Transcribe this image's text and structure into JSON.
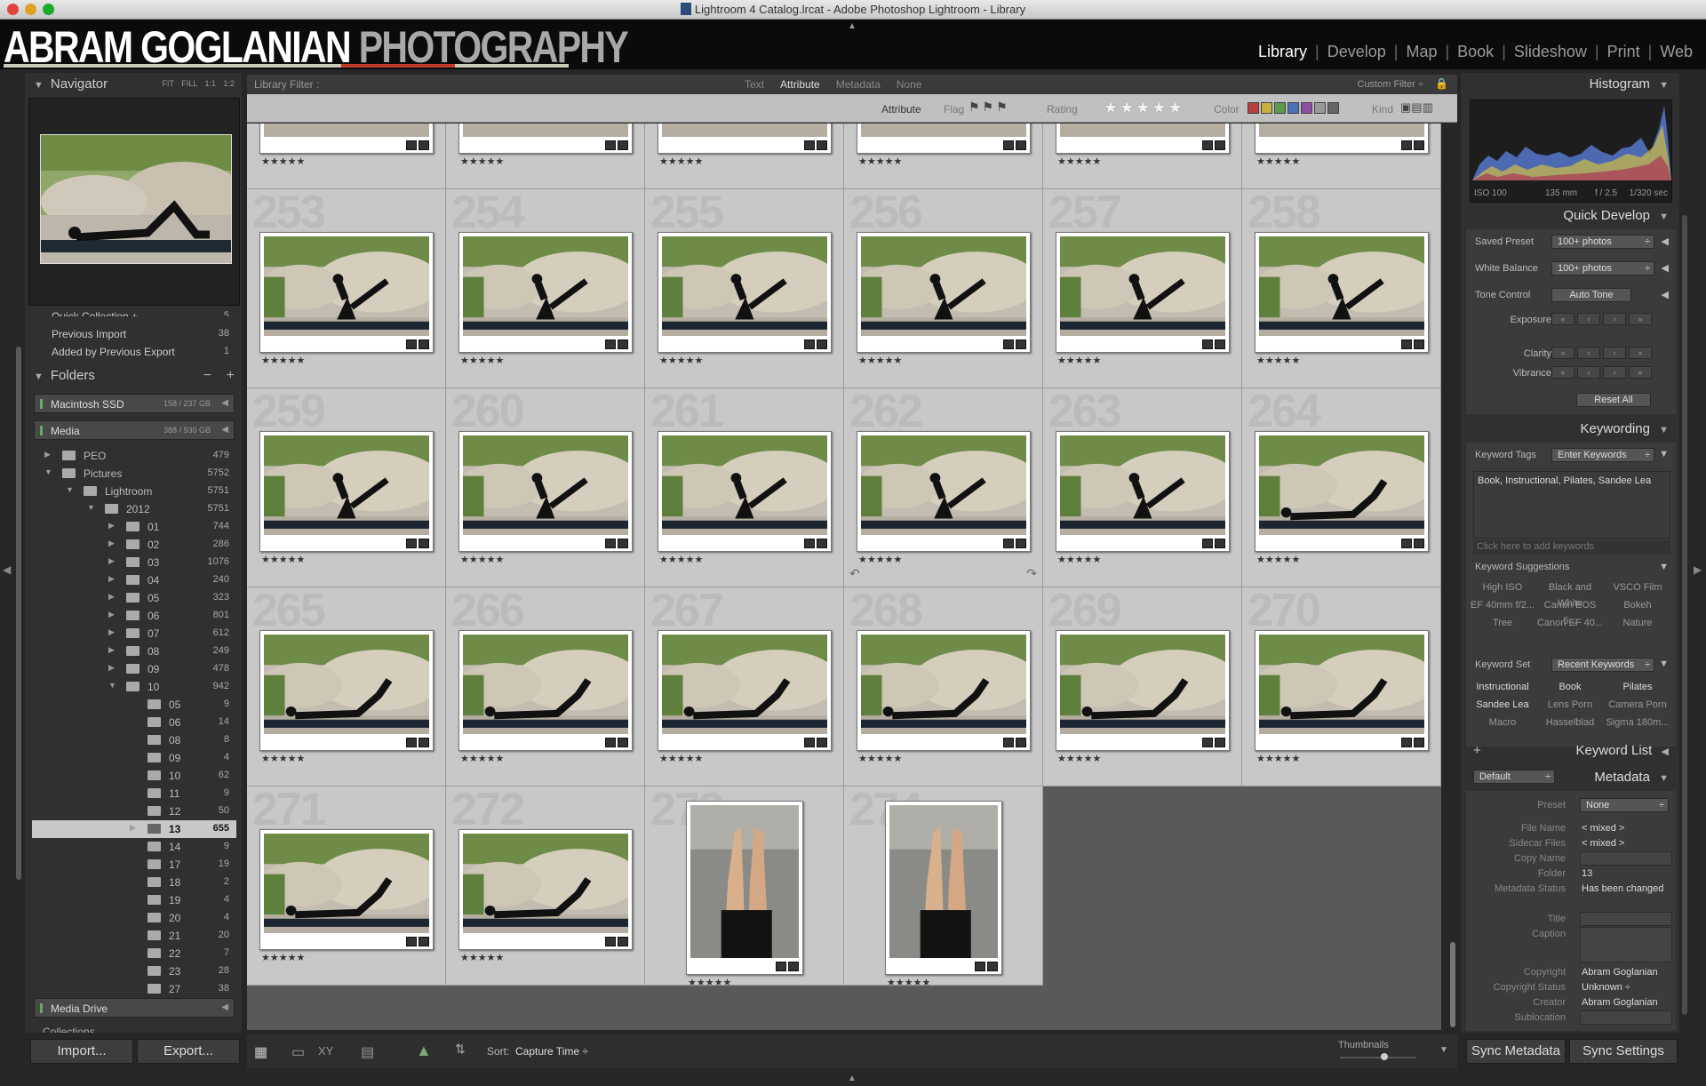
{
  "window": {
    "title": "Lightroom 4 Catalog.lrcat - Adobe Photoshop Lightroom - Library"
  },
  "identity": {
    "name_part1": "ABRAM GOGLANIAN",
    "name_part2": "PHOTOGRAPHY"
  },
  "modules": [
    "Library",
    "Develop",
    "Map",
    "Book",
    "Slideshow",
    "Print",
    "Web"
  ],
  "left": {
    "navigator": {
      "title": "Navigator",
      "zoom": [
        "FIT",
        "FILL",
        "1:1",
        "1:2"
      ]
    },
    "catalog": [
      {
        "label": "Quick Collection +",
        "count": "5"
      },
      {
        "label": "Previous Import",
        "count": "38"
      },
      {
        "label": "Added by Previous Export",
        "count": "1"
      }
    ],
    "folders": {
      "title": "Folders",
      "minus": "−",
      "plus": "+"
    },
    "volumes": [
      {
        "name": "Macintosh SSD",
        "size": "158 / 237 GB"
      },
      {
        "name": "Media",
        "size": "388 / 930 GB"
      },
      {
        "name": "Media Drive",
        "size": ""
      }
    ],
    "tree": [
      {
        "name": "PEO",
        "count": "479",
        "depth": 0,
        "arrow": "▶"
      },
      {
        "name": "Pictures",
        "count": "5752",
        "depth": 0,
        "arrow": "▼"
      },
      {
        "name": "Lightroom",
        "count": "5751",
        "depth": 1,
        "arrow": "▼"
      },
      {
        "name": "2012",
        "count": "5751",
        "depth": 2,
        "arrow": "▼"
      },
      {
        "name": "01",
        "count": "744",
        "depth": 3,
        "arrow": "▶"
      },
      {
        "name": "02",
        "count": "286",
        "depth": 3,
        "arrow": "▶"
      },
      {
        "name": "03",
        "count": "1076",
        "depth": 3,
        "arrow": "▶"
      },
      {
        "name": "04",
        "count": "240",
        "depth": 3,
        "arrow": "▶"
      },
      {
        "name": "05",
        "count": "323",
        "depth": 3,
        "arrow": "▶"
      },
      {
        "name": "06",
        "count": "801",
        "depth": 3,
        "arrow": "▶"
      },
      {
        "name": "07",
        "count": "612",
        "depth": 3,
        "arrow": "▶"
      },
      {
        "name": "08",
        "count": "249",
        "depth": 3,
        "arrow": "▶"
      },
      {
        "name": "09",
        "count": "478",
        "depth": 3,
        "arrow": "▶"
      },
      {
        "name": "10",
        "count": "942",
        "depth": 3,
        "arrow": "▼"
      },
      {
        "name": "05",
        "count": "9",
        "depth": 4,
        "arrow": ""
      },
      {
        "name": "06",
        "count": "14",
        "depth": 4,
        "arrow": ""
      },
      {
        "name": "08",
        "count": "8",
        "depth": 4,
        "arrow": ""
      },
      {
        "name": "09",
        "count": "4",
        "depth": 4,
        "arrow": ""
      },
      {
        "name": "10",
        "count": "62",
        "depth": 4,
        "arrow": ""
      },
      {
        "name": "11",
        "count": "9",
        "depth": 4,
        "arrow": ""
      },
      {
        "name": "12",
        "count": "50",
        "depth": 4,
        "arrow": ""
      },
      {
        "name": "13",
        "count": "655",
        "depth": 4,
        "arrow": "▶",
        "selected": true
      },
      {
        "name": "14",
        "count": "9",
        "depth": 4,
        "arrow": ""
      },
      {
        "name": "17",
        "count": "19",
        "depth": 4,
        "arrow": ""
      },
      {
        "name": "18",
        "count": "2",
        "depth": 4,
        "arrow": ""
      },
      {
        "name": "19",
        "count": "4",
        "depth": 4,
        "arrow": ""
      },
      {
        "name": "20",
        "count": "4",
        "depth": 4,
        "arrow": ""
      },
      {
        "name": "21",
        "count": "20",
        "depth": 4,
        "arrow": ""
      },
      {
        "name": "22",
        "count": "7",
        "depth": 4,
        "arrow": ""
      },
      {
        "name": "23",
        "count": "28",
        "depth": 4,
        "arrow": ""
      },
      {
        "name": "27",
        "count": "38",
        "depth": 4,
        "arrow": ""
      }
    ],
    "collections_label": "Collections",
    "import": "Import...",
    "export": "Export..."
  },
  "filter": {
    "title": "Library Filter :",
    "tabs": [
      "Text",
      "Attribute",
      "Metadata",
      "None"
    ],
    "preset": "Custom Filter ÷",
    "attribute": "Attribute",
    "flag": "Flag",
    "rating": "Rating",
    "color": "Color",
    "kind": "Kind",
    "stars": "★★★★★"
  },
  "grid": {
    "stars": "★★★★★",
    "cells": [
      {
        "n": "",
        "type": "plank"
      },
      {
        "n": "",
        "type": "plank"
      },
      {
        "n": "",
        "type": "plank"
      },
      {
        "n": "",
        "type": "plank"
      },
      {
        "n": "",
        "type": "plank"
      },
      {
        "n": "",
        "type": "plank"
      },
      {
        "n": "253",
        "type": "v"
      },
      {
        "n": "254",
        "type": "v"
      },
      {
        "n": "255",
        "type": "v"
      },
      {
        "n": "256",
        "type": "v"
      },
      {
        "n": "257",
        "type": "v"
      },
      {
        "n": "258",
        "type": "v"
      },
      {
        "n": "259",
        "type": "v"
      },
      {
        "n": "260",
        "type": "v"
      },
      {
        "n": "261",
        "type": "v"
      },
      {
        "n": "262",
        "type": "v"
      },
      {
        "n": "263",
        "type": "v"
      },
      {
        "n": "264",
        "type": "lie"
      },
      {
        "n": "265",
        "type": "lie"
      },
      {
        "n": "266",
        "type": "lie"
      },
      {
        "n": "267",
        "type": "lie"
      },
      {
        "n": "268",
        "type": "lie"
      },
      {
        "n": "269",
        "type": "lie"
      },
      {
        "n": "270",
        "type": "lie"
      },
      {
        "n": "271",
        "type": "lie"
      },
      {
        "n": "272",
        "type": "lie"
      },
      {
        "n": "273",
        "type": "feet"
      },
      {
        "n": "274",
        "type": "feet"
      }
    ]
  },
  "toolbar": {
    "sort_label": "Sort:",
    "sort_value": "Capture Time ÷",
    "thumbs": "Thumbnails"
  },
  "right": {
    "histogram": {
      "title": "Histogram",
      "iso": "ISO 100",
      "focal": "135 mm",
      "aperture": "f / 2.5",
      "shutter": "1/320 sec"
    },
    "quick_develop": {
      "title": "Quick Develop",
      "saved_preset": "Saved Preset",
      "saved_preset_val": "100+ photos",
      "wb": "White Balance",
      "wb_val": "100+ photos",
      "tone": "Tone Control",
      "auto_tone": "Auto Tone",
      "exposure": "Exposure",
      "clarity": "Clarity",
      "vibrance": "Vibrance",
      "reset": "Reset All"
    },
    "keywording": {
      "title": "Keywording",
      "tags_label": "Keyword Tags",
      "tags_mode": "Enter Keywords",
      "tags": "Book, Instructional, Pilates, Sandee Lea",
      "add": "Click here to add keywords",
      "suggestions": "Keyword Suggestions",
      "sugg": [
        "High ISO",
        "Black and White",
        "VSCO Film",
        "EF 40mm f/2...",
        "Canon EOS 5...",
        "Bokeh",
        "Tree",
        "Canon EF 40...",
        "Nature"
      ],
      "set_label": "Keyword Set",
      "set_val": "Recent Keywords",
      "set": [
        "Instructional",
        "Book",
        "Pilates",
        "Sandee Lea",
        "Lens Porn",
        "Camera Porn",
        "Macro",
        "Hasselblad",
        "Sigma 180m..."
      ]
    },
    "keyword_list": {
      "title": "Keyword List",
      "plus": "+"
    },
    "metadata": {
      "title": "Metadata",
      "preset_sel": "Default",
      "preset_label": "Preset",
      "preset_val": "None",
      "fields": [
        {
          "k": "File Name",
          "v": "< mixed >"
        },
        {
          "k": "Sidecar Files",
          "v": "< mixed >"
        },
        {
          "k": "Copy Name",
          "v": ""
        },
        {
          "k": "Folder",
          "v": "13"
        },
        {
          "k": "Metadata Status",
          "v": "Has been changed"
        },
        {
          "k": "Title",
          "v": ""
        },
        {
          "k": "Caption",
          "v": ""
        },
        {
          "k": "Copyright",
          "v": "Abram Goglanian"
        },
        {
          "k": "Copyright Status",
          "v": "Unknown ÷"
        },
        {
          "k": "Creator",
          "v": "Abram Goglanian"
        },
        {
          "k": "Sublocation",
          "v": ""
        }
      ]
    },
    "sync_meta": "Sync Metadata",
    "sync_set": "Sync Settings"
  },
  "colors": {
    "accent_red": "#c0392b",
    "swatches": [
      "#b84040",
      "#c8b040",
      "#5a9a4a",
      "#4a70b8",
      "#8a50a8",
      "#999999",
      "#666666"
    ]
  }
}
